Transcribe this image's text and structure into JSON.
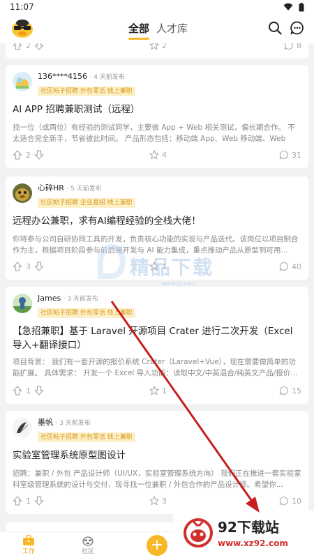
{
  "status": {
    "time": "11:07"
  },
  "header": {
    "tabs": [
      {
        "label": "全部"
      },
      {
        "label": "人才库"
      }
    ]
  },
  "prev_card": {
    "up": "2",
    "stars": "2",
    "comments": "8"
  },
  "posts": [
    {
      "author": "136****4156",
      "time": "· 4 天前发布",
      "tag": "社区帖子招聘 外包零活 线上兼职",
      "title": "AI APP 招聘兼职测试（远程）",
      "excerpt": "找一位（或两位）有经验的测试同学，主要做 App + Web 相关测试，偏长期合作。 不太适合完全新手，节省彼此时间。 产品形态包括：移动端 App、Web 移动端、Web 网...",
      "up": "2",
      "stars": "4",
      "comments": "31"
    },
    {
      "author": "心碎HR",
      "time": "· 5 天前发布",
      "tag": "社区帖子招聘 企业直招 线上兼职",
      "title": "远程办公兼职，求有AI编程经验的全栈大佬！",
      "excerpt": "你将参与公司自研协同工具的开发，负责核心功能的实现与产品迭代。该岗位以项目制合作为主，根据项目阶段参与前后端开发与 AI 能力集成，重点推动产品从原型到可用...",
      "up": "3",
      "stars": "1",
      "comments": "40"
    },
    {
      "author": "James",
      "time": "· 3 天前发布",
      "tag": "社区帖子招聘 外包零活 线上兼职",
      "title": "【急招兼职】基于 Laravel 开源项目 Crater 进行二次开发（Excel导入+翻译接口）",
      "excerpt": "项目背景： 我们有一套开源的报价系统 Crater（Laravel+Vue），现在需要做简单的功能扩展。 具体需求： 开发一个 Excel 导入功能：读取中文/中英混合/纯英文产品/报价...",
      "up": "1",
      "stars": "1",
      "comments": "15"
    },
    {
      "author": "墨帆",
      "time": "· 3 天前发布",
      "tag": "社区帖子招聘 外包零活 线上兼职",
      "title": "实验室管理系统原型图设计",
      "excerpt": "招聘：兼职 / 外包 产品设计师（UI/UX，实验室管理系统方向） 我们正在推进一套实验室科室级管理系统的设计与交付，现寻找一位兼职 / 外包合作的产品设计师。希望你...",
      "up": "1",
      "stars": "3",
      "comments": "10"
    }
  ],
  "bottom_nav": [
    {
      "label": "工作"
    },
    {
      "label": "社区"
    }
  ],
  "watermark": {
    "text": "精品下载",
    "url": "www.jb.com"
  },
  "download_badge": {
    "title": "92下载站",
    "url": "www.xz92.com"
  },
  "colors": {
    "accent": "#f6b829",
    "tag_bg": "#fdf0c9",
    "tag_fg": "#d79a17",
    "arrow": "#c81e1e"
  }
}
